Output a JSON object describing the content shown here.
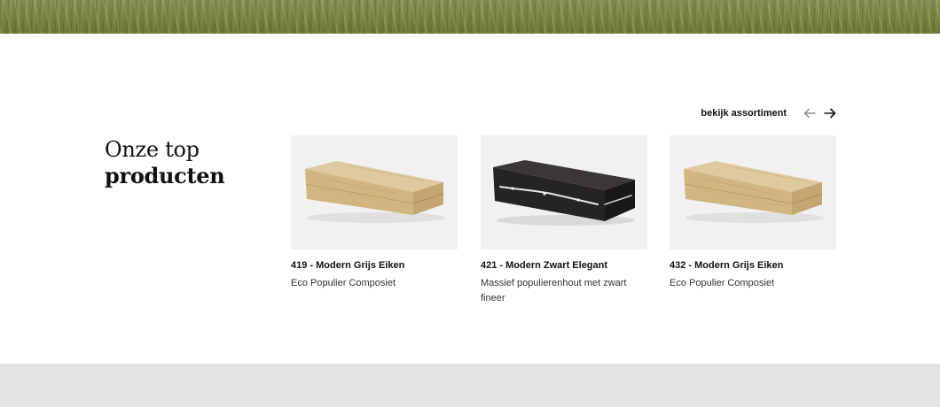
{
  "section": {
    "title_line1": "Onze top",
    "title_line2": "producten"
  },
  "nav": {
    "assortment_link": "bekijk assortiment",
    "prev_icon": "arrow-left-icon",
    "next_icon": "arrow-right-icon"
  },
  "products": [
    {
      "title": "419 - Modern Grijs Eiken",
      "subtitle": "Eco Populier Composiet",
      "finish": "light-oak"
    },
    {
      "title": "421 - Modern Zwart Elegant",
      "subtitle": "Massief populierenhout met zwart fineer",
      "finish": "black"
    },
    {
      "title": "432 - Modern Grijs Eiken",
      "subtitle": "Eco Populier Composiet",
      "finish": "light-oak"
    }
  ],
  "colors": {
    "card_background": "#f1f1f1",
    "footer_band": "#e3e4e2",
    "oak_top": "#dcc49a",
    "oak_side": "#c9ac7a",
    "black_top": "#2e2c2b",
    "black_side": "#1c1b1a"
  }
}
